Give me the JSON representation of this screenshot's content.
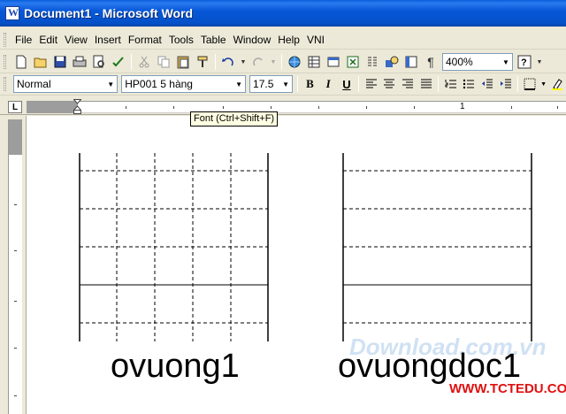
{
  "window": {
    "title": "Document1 - Microsoft Word"
  },
  "menu": [
    "File",
    "Edit",
    "View",
    "Insert",
    "Format",
    "Tools",
    "Table",
    "Window",
    "Help",
    "VNI"
  ],
  "toolbar": {
    "zoom": "400%",
    "help_glyph": "?"
  },
  "format_bar": {
    "style": "Normal",
    "font": "HP001 5 hàng",
    "size": "17.5",
    "bold": "B",
    "italic": "I",
    "underline": "U"
  },
  "ruler": {
    "tab_selector": "L",
    "mark": "1"
  },
  "tooltip": "Font (Ctrl+Shift+F)",
  "document": {
    "captions": [
      "ovuong1",
      "ovuongdoc1"
    ]
  },
  "watermarks": {
    "download": "Download.com.vn",
    "site": "WWW.TCTEDU.COM"
  },
  "colors": {
    "title_bar": "#0a5fd8",
    "chrome": "#ece9d8",
    "ruler_margin": "#9d9d9d",
    "watermark_red": "#e01010"
  },
  "icons": [
    "new-icon",
    "open-icon",
    "save-icon",
    "print-icon",
    "print-preview-icon",
    "spelling-icon",
    "cut-icon",
    "copy-icon",
    "paste-icon",
    "format-painter-icon",
    "undo-icon",
    "redo-icon",
    "hyperlink-icon",
    "tables-icon",
    "insert-table-icon",
    "excel-icon",
    "columns-icon",
    "drawing-icon",
    "document-map-icon",
    "show-hide-icon",
    "help-icon"
  ]
}
